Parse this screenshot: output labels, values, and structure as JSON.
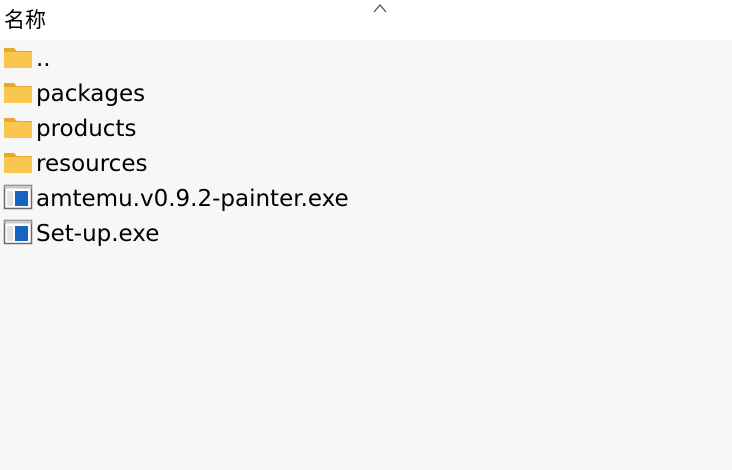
{
  "header": {
    "name_column_label": "名称",
    "sort_icon": "chevron-up-icon"
  },
  "files": [
    {
      "name": "..",
      "icon": "folder-icon"
    },
    {
      "name": "packages",
      "icon": "folder-icon"
    },
    {
      "name": "products",
      "icon": "folder-icon"
    },
    {
      "name": "resources",
      "icon": "folder-icon"
    },
    {
      "name": "amtemu.v0.9.2-painter.exe",
      "icon": "executable-icon"
    },
    {
      "name": "Set-up.exe",
      "icon": "executable-icon"
    }
  ],
  "colors": {
    "background": "#f7f7f7",
    "header_background": "#ffffff",
    "folder_body": "#f9c74f",
    "folder_tab": "#e8a92a",
    "exe_blue": "#1565c0"
  }
}
